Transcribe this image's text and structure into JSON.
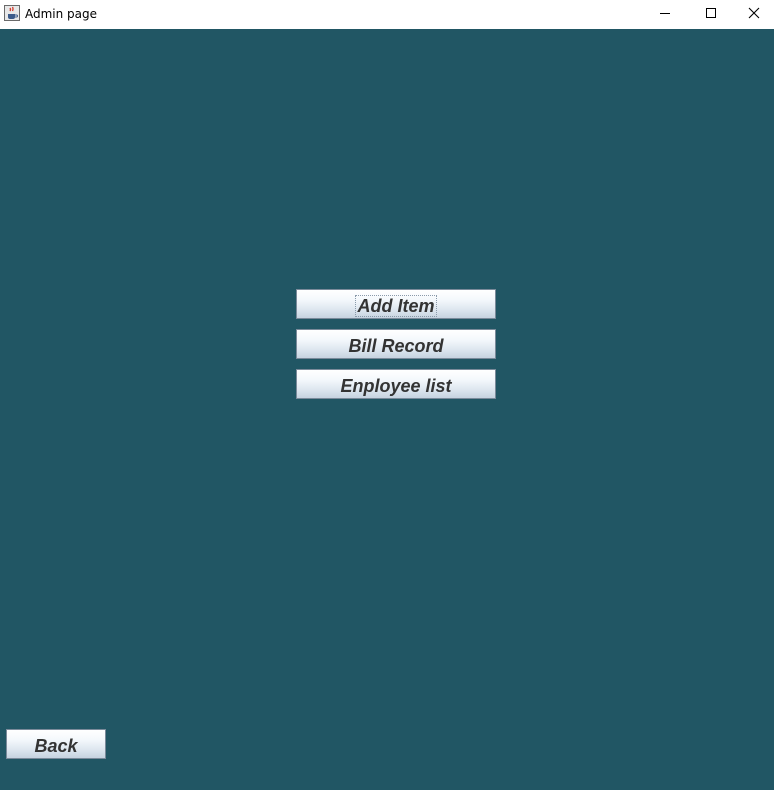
{
  "window": {
    "title": "Admin page",
    "icon": "java-coffee-cup-icon",
    "controls": {
      "minimize_icon": "minimize-icon",
      "maximize_icon": "maximize-icon",
      "close_icon": "close-icon"
    }
  },
  "colors": {
    "background": "#215664",
    "button_text": "#333333",
    "titlebar": "#ffffff"
  },
  "menu": {
    "add_item_label": "Add Item",
    "bill_record_label": "Bill Record",
    "employee_list_label": "Enployee list"
  },
  "footer": {
    "back_label": "Back"
  }
}
